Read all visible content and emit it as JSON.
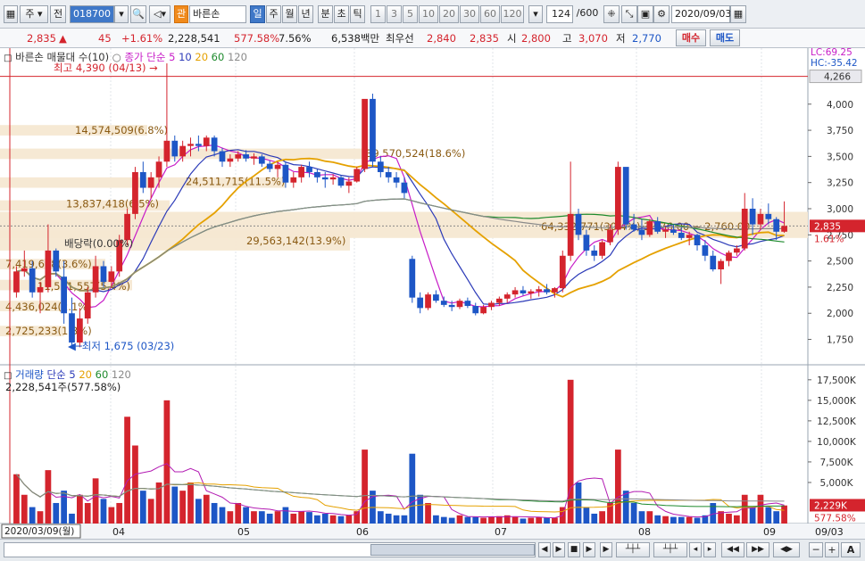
{
  "toolbar": {
    "period_label": "주",
    "prev_label": "전",
    "stock_code": "018700",
    "stock_name": "바른손",
    "stock_badge": "관",
    "period_tabs": [
      "일",
      "주",
      "월",
      "년",
      "분",
      "초",
      "틱"
    ],
    "interval_tabs": [
      "1",
      "3",
      "5",
      "10",
      "20",
      "30",
      "60",
      "120"
    ],
    "count": "124",
    "count_total": "/600",
    "date": "2020/09/03"
  },
  "quote": {
    "price": "2,835",
    "arrow": "▲",
    "change": "45",
    "change_pct": "+1.61%",
    "volume": "2,228,541",
    "volume_ratio": "577.58%",
    "turnover_pct": "7.56%",
    "amount": "6,538백만",
    "best_ask_label": "최우선",
    "best_ask": "2,840",
    "best_bid": "2,835",
    "open_label": "시",
    "open": "2,800",
    "high_label": "고",
    "high": "3,070",
    "low_label": "저",
    "low": "2,770",
    "buy_label": "매수",
    "sell_label": "매도"
  },
  "price_chart": {
    "title": "바른손 매물대 수(10)",
    "ma_title": "종가 단순",
    "ma_periods": [
      "5",
      "10",
      "20",
      "60",
      "120"
    ],
    "ma_colors": [
      "#c71cc7",
      "#2b3ab8",
      "#e5a100",
      "#1d8a2c",
      "#8a8a8a"
    ],
    "max_marker": "최고 4,390 (04/13)",
    "min_marker": "최저 1,675 (03/23)",
    "dividend_marker": "배당락(0.00%)",
    "lc_label": "LC:69.25",
    "hc_label": "HC:-35.42",
    "top_price_tag": "4,266",
    "price_tag": "2,835",
    "pct_tag": "1.61%",
    "y_ticks": [
      "4,000",
      "3,750",
      "3,500",
      "3,250",
      "3,000",
      "2,750",
      "2,500",
      "2,250",
      "2,000",
      "1,750"
    ],
    "volume_profile": [
      {
        "label": "39,570,524(18.6%)"
      },
      {
        "label": "14,574,509(6.8%)"
      },
      {
        "label": "24,511,715(11.5%)"
      },
      {
        "label": "13,837,418(6.5%)"
      },
      {
        "label": "64,332,771(30.4%)  3,976.00 ~ 2,760.00"
      },
      {
        "label": "29,563,142(13.9%)"
      },
      {
        "label": "7,419,608(3.6%)"
      },
      {
        "label": "11,531,557(5.4%)"
      },
      {
        "label": "4,436,024(2.1%)"
      },
      {
        "label": "2,725,233(1.3%)"
      }
    ]
  },
  "volume_chart": {
    "title": "거래량",
    "ma_title": "단순",
    "ma_periods": [
      "5",
      "20",
      "60",
      "120"
    ],
    "value_label": "2,228,541주(577.58%)",
    "y_ticks": [
      "17,500K",
      "15,000K",
      "12,500K",
      "10,000K",
      "7,500K",
      "5,000K"
    ],
    "vol_tag": "2,229K",
    "vol_pct_tag": "577.58%"
  },
  "x_axis": {
    "start_label": "2020/03/09(월)",
    "months": [
      "04",
      "05",
      "06",
      "07",
      "08",
      "09"
    ],
    "end_label": "09/03"
  },
  "candles": [
    [
      2200,
      2450,
      2150,
      2400
    ],
    [
      2400,
      2600,
      2350,
      2430
    ],
    [
      2430,
      2500,
      2150,
      2200
    ],
    [
      2200,
      2300,
      2000,
      2250
    ],
    [
      2250,
      2850,
      2200,
      2600
    ],
    [
      2600,
      2620,
      2350,
      2400
    ],
    [
      2350,
      2500,
      1900,
      2000
    ],
    [
      2000,
      2150,
      1680,
      1720
    ],
    [
      1720,
      2050,
      1675,
      1950
    ],
    [
      1950,
      2250,
      1900,
      2200
    ],
    [
      2200,
      2550,
      2150,
      2450
    ],
    [
      2450,
      2500,
      2250,
      2300
    ],
    [
      2300,
      2450,
      2250,
      2400
    ],
    [
      2400,
      2750,
      2350,
      2700
    ],
    [
      2700,
      3000,
      2650,
      2950
    ],
    [
      2950,
      3400,
      2900,
      3350
    ],
    [
      3350,
      3450,
      3150,
      3200
    ],
    [
      3200,
      3350,
      3100,
      3300
    ],
    [
      3300,
      3500,
      3200,
      3450
    ],
    [
      3450,
      4390,
      3400,
      3650
    ],
    [
      3650,
      3700,
      3450,
      3500
    ],
    [
      3500,
      3650,
      3450,
      3600
    ],
    [
      3600,
      3680,
      3500,
      3620
    ],
    [
      3620,
      3700,
      3550,
      3600
    ],
    [
      3600,
      3700,
      3550,
      3680
    ],
    [
      3680,
      3700,
      3500,
      3550
    ],
    [
      3550,
      3580,
      3400,
      3450
    ],
    [
      3450,
      3520,
      3400,
      3480
    ],
    [
      3480,
      3550,
      3450,
      3520
    ],
    [
      3520,
      3560,
      3450,
      3480
    ],
    [
      3480,
      3530,
      3420,
      3500
    ],
    [
      3500,
      3520,
      3400,
      3430
    ],
    [
      3430,
      3460,
      3350,
      3380
    ],
    [
      3380,
      3450,
      3300,
      3420
    ],
    [
      3420,
      3450,
      3200,
      3250
    ],
    [
      3250,
      3350,
      3200,
      3300
    ],
    [
      3300,
      3420,
      3250,
      3400
    ],
    [
      3400,
      3450,
      3300,
      3350
    ],
    [
      3350,
      3380,
      3250,
      3300
    ],
    [
      3300,
      3350,
      3200,
      3280
    ],
    [
      3280,
      3330,
      3230,
      3300
    ],
    [
      3300,
      3320,
      3200,
      3220
    ],
    [
      3220,
      3300,
      3150,
      3260
    ],
    [
      3260,
      3400,
      3250,
      3380
    ],
    [
      3380,
      3550,
      3350,
      4050
    ],
    [
      4050,
      4100,
      3400,
      3450
    ],
    [
      3450,
      3500,
      3300,
      3350
    ],
    [
      3350,
      3400,
      3250,
      3300
    ],
    [
      3300,
      3350,
      3200,
      3250
    ],
    [
      3250,
      3300,
      3100,
      3150
    ],
    [
      2520,
      2550,
      2100,
      2150
    ],
    [
      2150,
      2200,
      2000,
      2050
    ],
    [
      2050,
      2200,
      2030,
      2180
    ],
    [
      2180,
      2220,
      2100,
      2120
    ],
    [
      2120,
      2160,
      2060,
      2080
    ],
    [
      2080,
      2120,
      2020,
      2060
    ],
    [
      2060,
      2140,
      2040,
      2120
    ],
    [
      2120,
      2150,
      2050,
      2070
    ],
    [
      2070,
      2100,
      1980,
      2000
    ],
    [
      2000,
      2080,
      1990,
      2060
    ],
    [
      2060,
      2120,
      2030,
      2100
    ],
    [
      2100,
      2160,
      2070,
      2140
    ],
    [
      2140,
      2200,
      2100,
      2180
    ],
    [
      2180,
      2250,
      2150,
      2220
    ],
    [
      2220,
      2260,
      2170,
      2190
    ],
    [
      2190,
      2230,
      2140,
      2210
    ],
    [
      2210,
      2260,
      2160,
      2230
    ],
    [
      2230,
      2280,
      2180,
      2200
    ],
    [
      2200,
      2250,
      2150,
      2240
    ],
    [
      2240,
      2600,
      2200,
      2550
    ],
    [
      2550,
      3450,
      2500,
      2950
    ],
    [
      2950,
      3000,
      2700,
      2750
    ],
    [
      2750,
      2800,
      2550,
      2600
    ],
    [
      2600,
      2650,
      2500,
      2550
    ],
    [
      2550,
      2700,
      2520,
      2680
    ],
    [
      2680,
      2850,
      2650,
      2800
    ],
    [
      2800,
      3450,
      2750,
      3400
    ],
    [
      3400,
      3050,
      2800,
      2850
    ],
    [
      2850,
      2950,
      2780,
      2800
    ],
    [
      2800,
      2900,
      2700,
      2750
    ],
    [
      2750,
      2900,
      2730,
      2880
    ],
    [
      2880,
      2920,
      2760,
      2780
    ],
    [
      2780,
      2830,
      2720,
      2800
    ],
    [
      2800,
      2850,
      2750,
      2770
    ],
    [
      2770,
      2820,
      2700,
      2720
    ],
    [
      2720,
      2780,
      2650,
      2750
    ],
    [
      2750,
      2760,
      2600,
      2650
    ],
    [
      2650,
      2700,
      2500,
      2550
    ],
    [
      2550,
      2600,
      2400,
      2420
    ],
    [
      2420,
      2520,
      2280,
      2500
    ],
    [
      2500,
      2600,
      2450,
      2580
    ],
    [
      2580,
      2650,
      2550,
      2620
    ],
    [
      2620,
      3150,
      2600,
      3000
    ],
    [
      3000,
      3100,
      2750,
      2850
    ],
    [
      2850,
      3000,
      2800,
      2950
    ],
    [
      2950,
      3050,
      2850,
      2900
    ],
    [
      2900,
      2920,
      2700,
      2780
    ],
    [
      2780,
      3070,
      2770,
      2835
    ]
  ],
  "volumes": [
    6.0,
    3.5,
    2.0,
    1.5,
    6.5,
    2.5,
    4.0,
    1.2,
    3.5,
    2.5,
    5.5,
    3.0,
    2.0,
    2.5,
    13.0,
    9.5,
    4.0,
    3.0,
    5.0,
    15.0,
    4.5,
    4.0,
    5.0,
    3.0,
    3.5,
    2.5,
    2.0,
    1.5,
    2.5,
    2.0,
    1.5,
    1.5,
    1.2,
    1.5,
    2.0,
    1.2,
    1.5,
    1.4,
    1.0,
    1.2,
    1.0,
    0.9,
    1.0,
    1.5,
    9.0,
    4.0,
    1.5,
    1.2,
    1.0,
    1.0,
    8.5,
    3.5,
    2.5,
    1.0,
    0.8,
    0.7,
    1.0,
    0.8,
    0.8,
    0.7,
    0.8,
    0.9,
    1.0,
    0.8,
    0.6,
    0.7,
    0.8,
    0.7,
    0.7,
    2.0,
    17.5,
    5.0,
    2.0,
    1.2,
    1.5,
    2.5,
    9.0,
    4.0,
    2.5,
    1.5,
    1.5,
    1.0,
    0.9,
    0.8,
    0.8,
    0.8,
    0.7,
    1.0,
    2.5,
    1.5,
    1.2,
    1.0,
    3.5,
    2.0,
    3.5,
    2.0,
    1.5,
    2.2
  ]
}
